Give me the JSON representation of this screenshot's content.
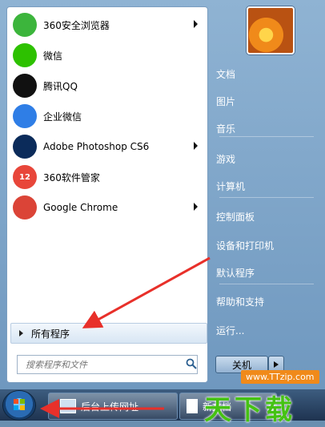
{
  "programs": [
    {
      "label": "360安全浏览器",
      "icon": "360-browser-icon",
      "color": "#3cb53c",
      "submenu": true
    },
    {
      "label": "微信",
      "icon": "wechat-icon",
      "color": "#2dc100",
      "submenu": false
    },
    {
      "label": "腾讯QQ",
      "icon": "qq-penguin-icon",
      "color": "#111111",
      "submenu": false
    },
    {
      "label": "企业微信",
      "icon": "wecom-icon",
      "color": "#2f7ee6",
      "submenu": false
    },
    {
      "label": "Adobe Photoshop CS6",
      "icon": "photoshop-icon",
      "color": "#0b2b5a",
      "submenu": true
    },
    {
      "label": "360软件管家",
      "icon": "360-software-manager-icon",
      "color": "#e8463a",
      "badge": "12",
      "submenu": false
    },
    {
      "label": "Google Chrome",
      "icon": "chrome-icon",
      "color": "#db4437",
      "submenu": true
    }
  ],
  "all_programs_label": "所有程序",
  "search": {
    "placeholder": "搜索程序和文件"
  },
  "right_items": [
    "文档",
    "图片",
    "音乐",
    "游戏",
    "计算机",
    "控制面板",
    "设备和打印机",
    "默认程序",
    "帮助和支持",
    "运行..."
  ],
  "shutdown_label": "关机",
  "taskbar": {
    "item1": "后台上传网址",
    "item2": "新文档"
  },
  "watermark": {
    "brand": "天下载",
    "url": "www.TTzip.com"
  },
  "colors": {
    "arrow": "#e8302a",
    "accent": "#2a6bb3"
  }
}
